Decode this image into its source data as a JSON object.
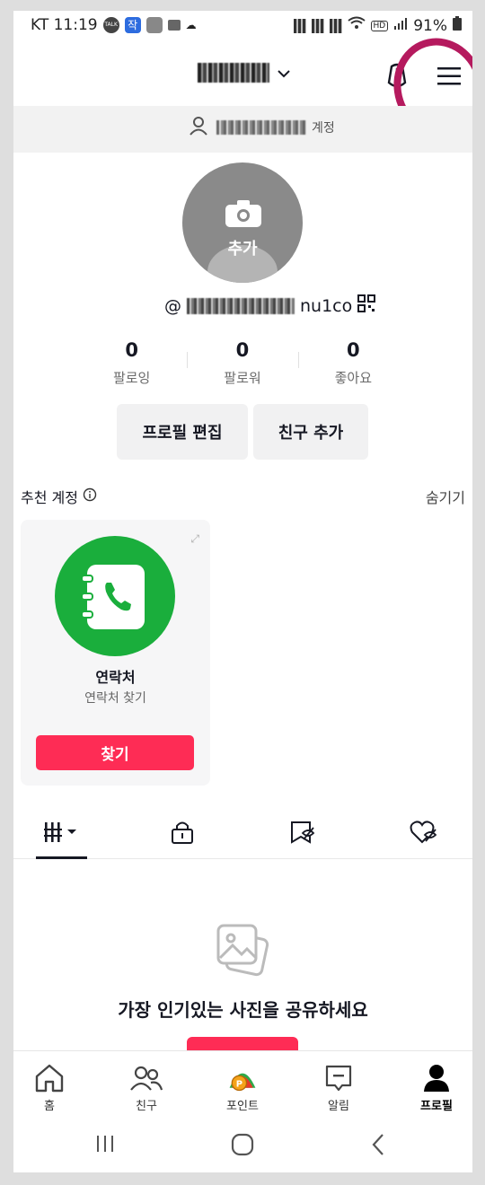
{
  "status_bar": {
    "carrier_time": "KT 11:19",
    "battery": "91%",
    "notif_icons": [
      "talk-icon",
      "ja-icon",
      "gallery-icon",
      "screen-icon",
      "cloud-icon"
    ],
    "talk_label": "TALK",
    "ja_label": "작",
    "hd_label": "HD"
  },
  "header": {
    "account_name": "",
    "dropdown_icon": "chevron-down-icon",
    "left_icon": "creator-tools-icon",
    "menu_icon": "hamburger-menu-icon"
  },
  "switch_account": {
    "text": "계정"
  },
  "profile": {
    "avatar_add_label": "추가",
    "username_prefix": "@",
    "username_suffix": "nu1co",
    "stats": [
      {
        "value": "0",
        "label": "팔로잉"
      },
      {
        "value": "0",
        "label": "팔로워"
      },
      {
        "value": "0",
        "label": "좋아요"
      }
    ],
    "edit_profile": "프로필 편집",
    "add_friend": "친구 추가"
  },
  "suggested": {
    "title": "추천 계정",
    "hide": "숨기기",
    "card": {
      "name": "연락처",
      "subtitle": "연락처 찾기",
      "button": "찾기"
    }
  },
  "content_tabs": [
    "grid-icon",
    "lock-icon",
    "bookmark-icon",
    "liked-icon"
  ],
  "empty_state": {
    "text": "가장 인기있는 사진을 공유하세요"
  },
  "bottom_nav": [
    {
      "label": "홈",
      "icon": "home-icon"
    },
    {
      "label": "친구",
      "icon": "friends-icon"
    },
    {
      "label": "포인트",
      "icon": "points-icon"
    },
    {
      "label": "알림",
      "icon": "inbox-icon"
    },
    {
      "label": "프로필",
      "icon": "profile-icon",
      "active": true
    }
  ],
  "colors": {
    "accent": "#fe2c55",
    "contacts_green": "#1aae3c",
    "annotation_circle": "#b51a5e",
    "points_orange": "#f07a1a"
  }
}
